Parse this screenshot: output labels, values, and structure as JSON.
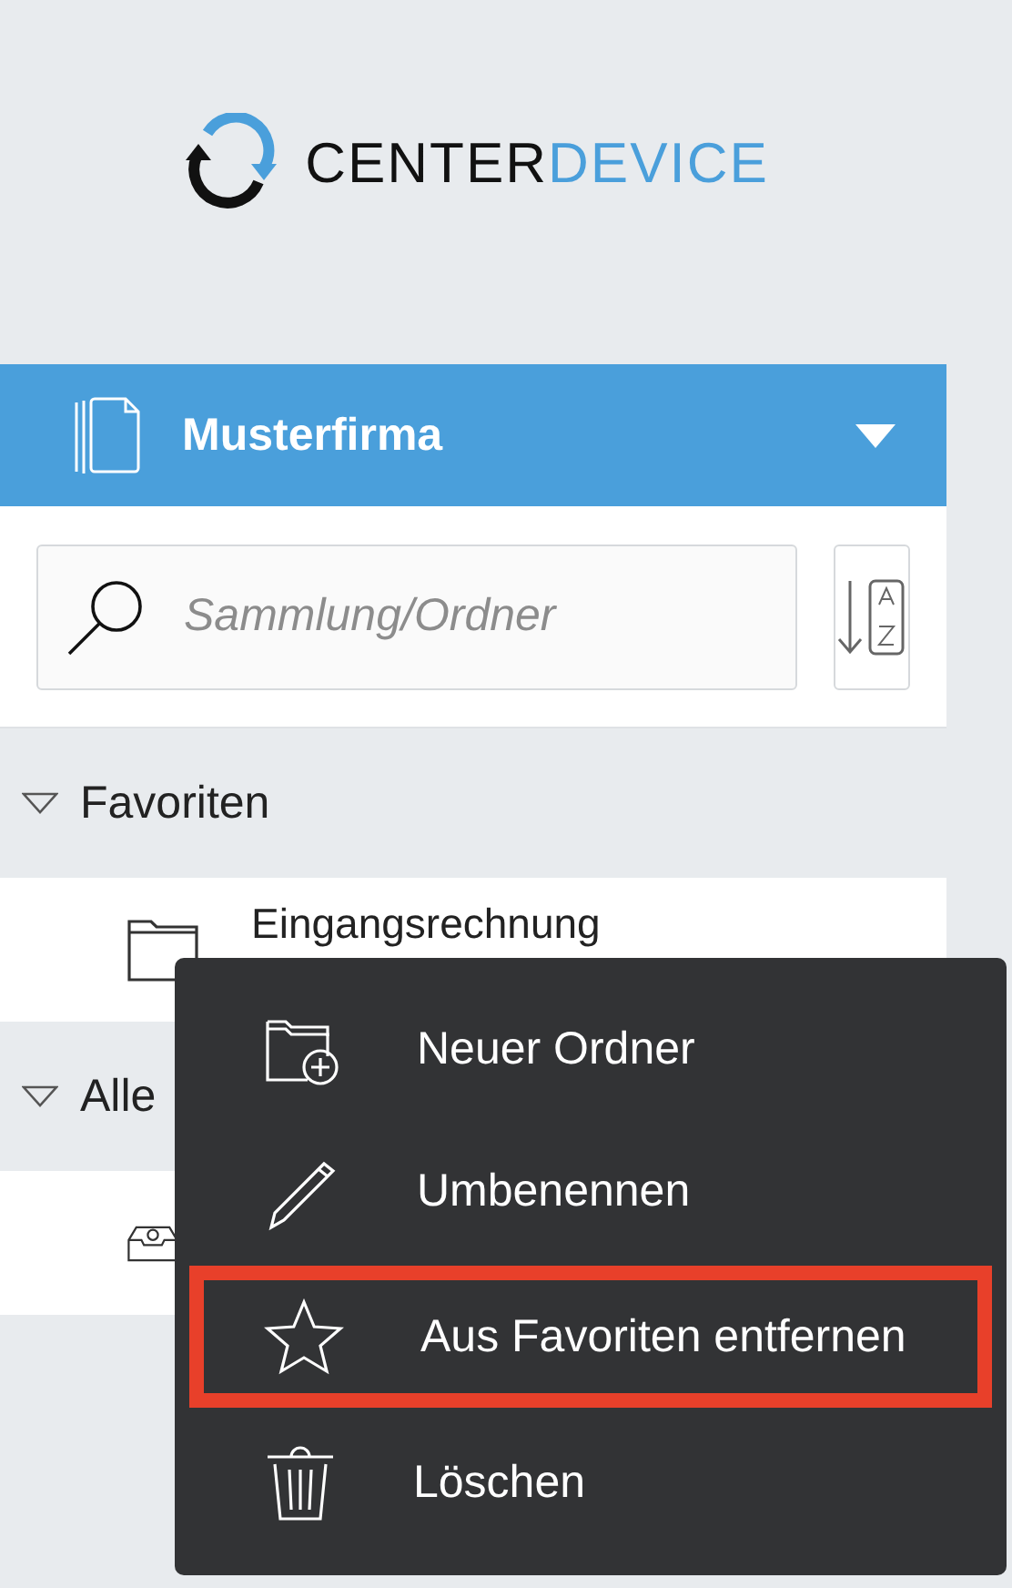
{
  "logo": {
    "part_1": "CENTER",
    "part_2": "DEVICE"
  },
  "workspace": {
    "name": "Musterfirma"
  },
  "search": {
    "placeholder": "Sammlung/Ordner"
  },
  "sections": [
    {
      "title": "Favoriten",
      "expanded": true,
      "items": [
        {
          "label": "Eingangsrechnung",
          "kind": "folder"
        }
      ]
    },
    {
      "title": "Alle",
      "expanded": true,
      "items": [
        {
          "kind": "inbox"
        }
      ]
    }
  ],
  "context_menu": [
    {
      "label": "Neuer Ordner",
      "kind": "new-folder",
      "highlighted": false
    },
    {
      "label": "Umbenennen",
      "kind": "rename",
      "highlighted": false
    },
    {
      "label": "Aus Favoriten entfernen",
      "kind": "star",
      "highlighted": true
    },
    {
      "label": "Löschen",
      "kind": "delete",
      "highlighted": false
    }
  ]
}
